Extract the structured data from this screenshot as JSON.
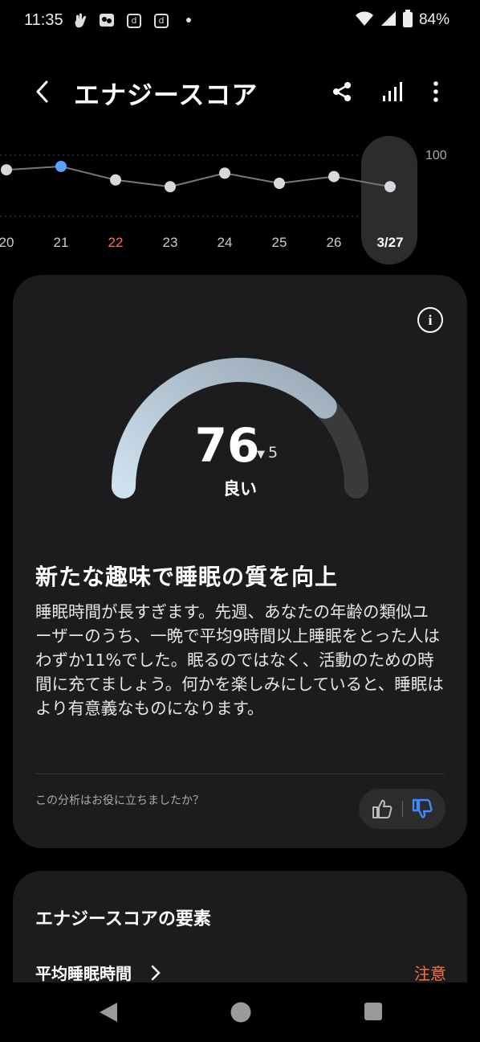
{
  "status_bar": {
    "time": "11:35",
    "battery": "84%",
    "icons": [
      "hand-icon",
      "media-icon",
      "docomo-icon",
      "docomo-icon",
      "dot-icon",
      "wifi-icon",
      "signal-icon",
      "battery-icon"
    ],
    "d_icon_label": "d"
  },
  "header": {
    "title": "エナジースコア",
    "back_icon": "back-arrow-icon",
    "share_icon": "share-icon",
    "stats_icon": "bar-chart-icon",
    "more_icon": "more-vertical-icon"
  },
  "trend": {
    "y_max_label": "100",
    "days": [
      {
        "label": "20",
        "score": 81
      },
      {
        "label": "21",
        "score": 82
      },
      {
        "label": "22",
        "score": 78
      },
      {
        "label": "23",
        "score": 76
      },
      {
        "label": "24",
        "score": 80
      },
      {
        "label": "25",
        "score": 77
      },
      {
        "label": "26",
        "score": 79
      },
      {
        "label": "3/27",
        "score": 76
      }
    ],
    "selected_index": 7,
    "highlight_index": 1,
    "sunday_index": 2,
    "highlight_color": "#5aa0ff",
    "sunday_color": "#ff6b6b"
  },
  "score": {
    "value": "76",
    "delta": "5",
    "delta_direction": "down",
    "rating": "良い",
    "fraction": 0.76,
    "info_label": "i"
  },
  "insight": {
    "title": "新たな趣味で睡眠の質を向上",
    "body": "睡眠時間が長すぎます。先週、あなたの年齢の類似ユーザーのうち、一晩で平均9時間以上睡眠をとった人はわずか11%でした。眠るのではなく、活動のための時間に充てましょう。何かを楽しみにしていると、睡眠はより有意義なものになります。"
  },
  "feedback": {
    "question": "この分析はお役に立ちましたか？",
    "thumb_up_icon": "thumbs-up-icon",
    "thumb_down_icon": "thumbs-down-icon",
    "selected": "down",
    "accent_color": "#3d8bff"
  },
  "factors": {
    "title": "エナジースコアの要素",
    "items": [
      {
        "label": "平均睡眠時間",
        "status": "注意",
        "status_color": "#ff7043"
      }
    ]
  },
  "nav": {
    "back_icon": "nav-back-icon",
    "home_icon": "nav-home-icon",
    "recents_icon": "nav-recents-icon"
  }
}
